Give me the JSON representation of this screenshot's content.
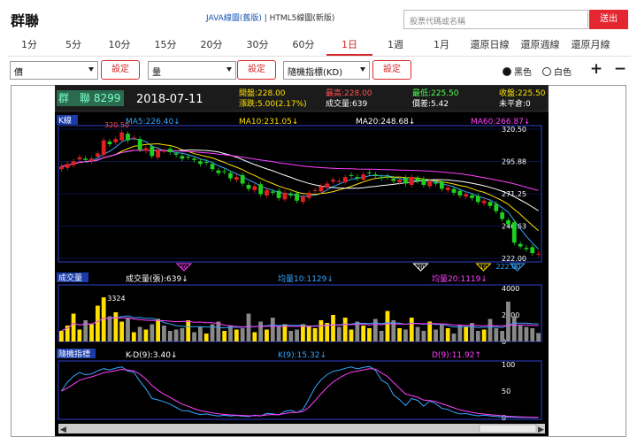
{
  "app": {
    "title": "群聯",
    "links": {
      "java": "JAVA線圖(舊版)",
      "sep": "|",
      "html5": "HTML5線圖(新版)"
    },
    "search_placeholder": "股票代碼或名稱",
    "search_button": "送出"
  },
  "periods": [
    "1分",
    "5分",
    "10分",
    "15分",
    "20分",
    "30分",
    "60分",
    "1日",
    "1週",
    "1月",
    "還原日線",
    "還原週線",
    "還原月線"
  ],
  "active_period": "1日",
  "controls": {
    "select1": "價",
    "select2": "量",
    "select3": "隨機指標(KD)",
    "set_label": "設定",
    "color_black": "黑色",
    "color_white": "白色",
    "zoom_in": "+",
    "zoom_out": "−"
  },
  "colors": {
    "red": "#e3262f",
    "accent": "#d62a2a",
    "up": "#e02020",
    "down": "#20d020",
    "ma5": "#35a6ff",
    "ma10": "#ffe000",
    "ma20": "#ffffff",
    "ma60": "#ff40ff"
  },
  "info": {
    "stock": "群　聯 8299",
    "date": "2018-07-11",
    "open": "開盤:228.00",
    "change": "漲跌:5.00(2.17%)",
    "high": "最高:228.00",
    "volume": "成交量:639",
    "low": "最低:225.50",
    "inventory": "價差:5.42",
    "close": "收盤:225.50",
    "unsettled": "未平倉:0"
  },
  "panels": {
    "kline": {
      "label": "K線",
      "ma5": "MA5:226.40↓",
      "ma10": "MA10:231.05↓",
      "ma20": "MA20:248.68↓",
      "ma60": "MA60:266.87↓",
      "high_mark": "320.50",
      "low_mark": "222.00",
      "yticks": [
        "320.50",
        "295.88",
        "271.25",
        "246.63",
        "222.00"
      ]
    },
    "volume": {
      "label": "成交量",
      "vol": "成交量(張):639↓",
      "ma10": "均量10:1129↓",
      "ma20": "均量20:1119↓",
      "peak": "3324",
      "yticks": [
        "4000",
        "2000",
        "0"
      ]
    },
    "kd": {
      "label": "隨機指標",
      "kd": "K-D(9):3.40↓",
      "k": "K(9):15.32↓",
      "d": "D(9):11.92↑",
      "yticks": [
        "100",
        "50",
        "0"
      ]
    }
  },
  "markers": [
    "60",
    "20",
    "10",
    "5"
  ],
  "chart_data": {
    "type": "candlestick",
    "closes": [
      292,
      294,
      296,
      299,
      297,
      298,
      302,
      312,
      309,
      313,
      318,
      312,
      314,
      305,
      306,
      300,
      305,
      304,
      303,
      301,
      298,
      299,
      297,
      294,
      295,
      290,
      287,
      288,
      283,
      284,
      279,
      275,
      277,
      271,
      274,
      272,
      268,
      272,
      270,
      266,
      269,
      272,
      274,
      277,
      279,
      282,
      281,
      284,
      285,
      283,
      286,
      287,
      285,
      283,
      284,
      281,
      282,
      279,
      284,
      281,
      278,
      281,
      279,
      275,
      276,
      272,
      270,
      271,
      268,
      265,
      266,
      262,
      258,
      252,
      248,
      234,
      231,
      229,
      226,
      225.5
    ],
    "volume": [
      800,
      1200,
      2100,
      900,
      1600,
      1300,
      2700,
      3324,
      1900,
      2200,
      1500,
      1800,
      700,
      1100,
      900,
      1300,
      1700,
      1200,
      800,
      900,
      1000,
      1600,
      700,
      1100,
      600,
      1300,
      1500,
      800,
      1200,
      900,
      1000,
      2100,
      700,
      1500,
      900,
      1800,
      1100,
      1300,
      800,
      900,
      1300,
      1200,
      1000,
      1600,
      1400,
      2000,
      1100,
      1800,
      900,
      1500,
      1200,
      1000,
      1700,
      800,
      2300,
      1600,
      1000,
      900,
      1800,
      1100,
      800,
      1500,
      900,
      1300,
      1000,
      600,
      1200,
      1100,
      1400,
      800,
      900,
      1700,
      1000,
      800,
      3000,
      1900,
      1200,
      1100,
      1000,
      639
    ],
    "ylim": [
      222.0,
      320.5
    ]
  }
}
